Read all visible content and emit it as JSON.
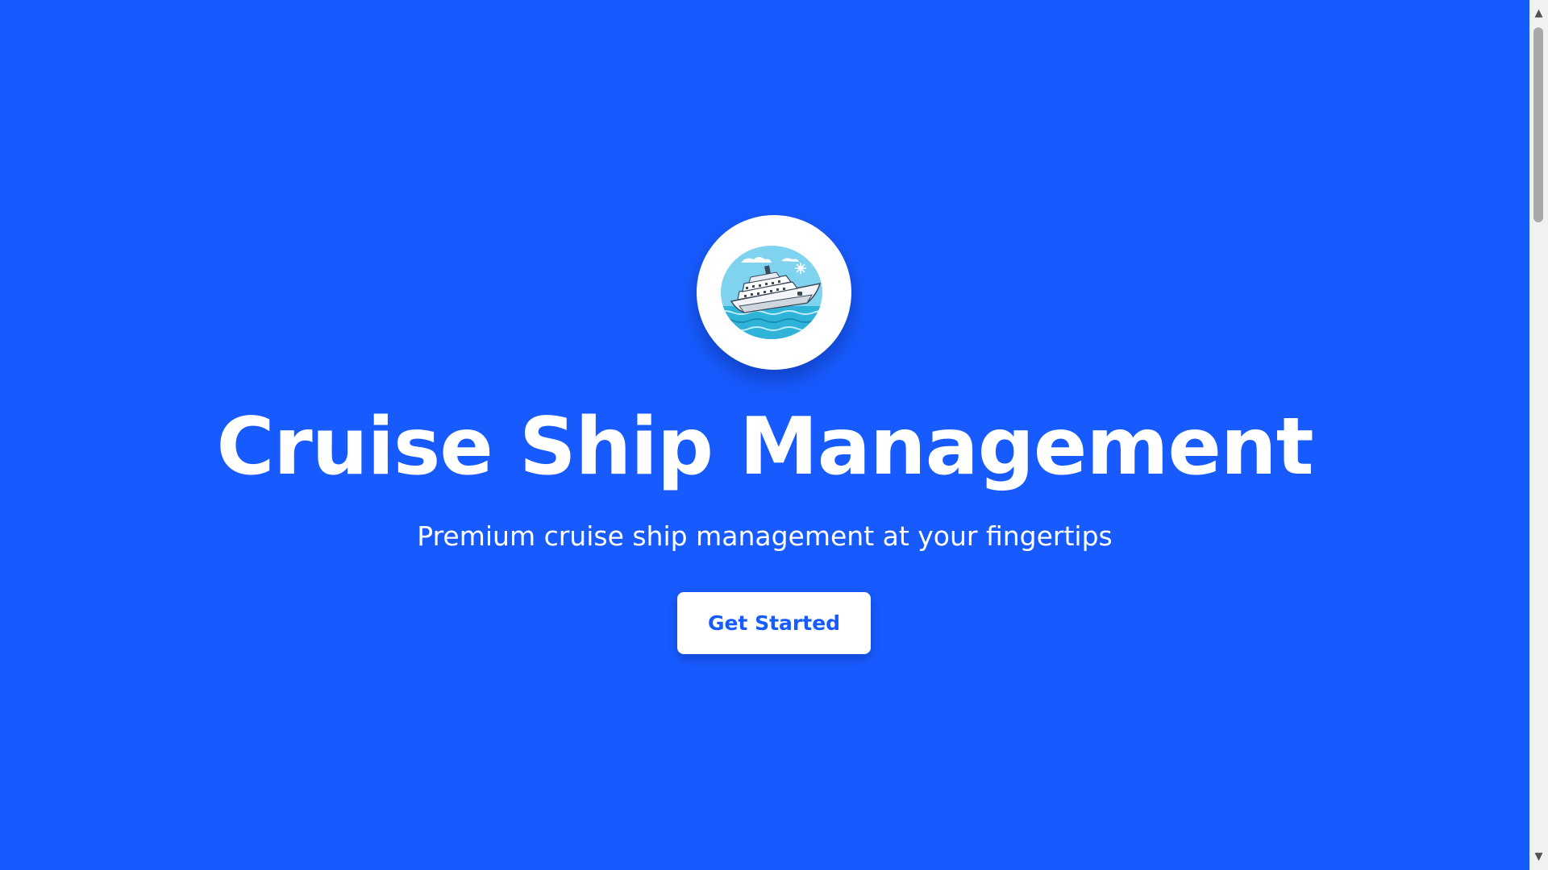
{
  "hero": {
    "logo_icon": "cruise-ship-icon",
    "title": "Cruise Ship Management",
    "subtitle": "Premium cruise ship management at your fingertips",
    "cta_label": "Get Started"
  },
  "colors": {
    "background": "#175bff",
    "foreground": "#ffffff",
    "button_text": "#175bff"
  },
  "scrollbar": {
    "up_arrow": "▲",
    "down_arrow": "▼"
  }
}
